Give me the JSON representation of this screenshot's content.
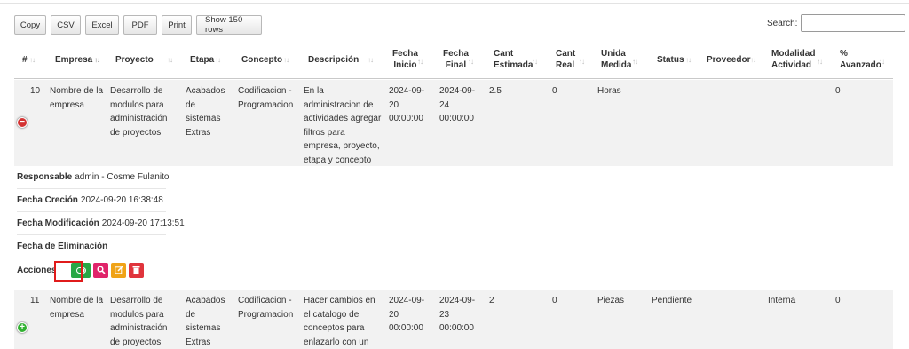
{
  "toolbar": {
    "copy": "Copy",
    "csv": "CSV",
    "excel": "Excel",
    "pdf": "PDF",
    "print": "Print",
    "show_rows": "Show 150 rows"
  },
  "search": {
    "label": "Search:",
    "value": ""
  },
  "columns": [
    "#",
    "Empresa",
    "Proyecto",
    "Etapa",
    "Concepto",
    "Descripción",
    "Fecha Inicio",
    "Fecha Final",
    "Cant Estimada",
    "Cant Real",
    "Unida Medida",
    "Status",
    "Proveedor",
    "Modalidad Actividad",
    "% Avanzado"
  ],
  "columns_display": {
    "id": "#",
    "empresa": "Empresa",
    "proyecto": "Proyecto",
    "etapa": "Etapa",
    "concepto": "Concepto",
    "descripcion": "Descripción",
    "fecha_inicio_1": "Fecha",
    "fecha_inicio_2": "Inicio",
    "fecha_final_1": "Fecha",
    "fecha_final_2": "Final",
    "cant_est_1": "Cant",
    "cant_est_2": "Estimada",
    "cant_real_1": "Cant",
    "cant_real_2": "Real",
    "unidad_1": "Unida",
    "unidad_2": "Medida",
    "status": "Status",
    "proveedor": "Proveedor",
    "modalidad_1": "Modalidad",
    "modalidad_2": "Actividad",
    "avance_1": "%",
    "avance_2": "Avanzado"
  },
  "rows": [
    {
      "id": "10",
      "empresa": [
        "Nombre de la",
        "empresa"
      ],
      "proyecto": [
        "Desarrollo de",
        "modulos para",
        "administración",
        "de proyectos"
      ],
      "etapa": [
        "Acabados",
        "de",
        "sistemas",
        "Extras"
      ],
      "concepto": [
        "Codificacion -",
        "Programacion"
      ],
      "descripcion": [
        "En la",
        "administracion de",
        "actividades agregar",
        "filtros para",
        "empresa, proyecto,",
        "etapa y concepto"
      ],
      "fecha_inicio": [
        "2024-09-",
        "20",
        "00:00:00"
      ],
      "fecha_final": [
        "2024-09-",
        "24",
        "00:00:00"
      ],
      "cant_estimada": "2.5",
      "cant_real": "0",
      "unidad": "Horas",
      "status": "",
      "proveedor": "",
      "modalidad": "",
      "avance": "0",
      "expanded": true
    },
    {
      "id": "11",
      "empresa": [
        "Nombre de la",
        "empresa"
      ],
      "proyecto": [
        "Desarrollo de",
        "modulos para",
        "administración",
        "de proyectos"
      ],
      "etapa": [
        "Acabados",
        "de",
        "sistemas",
        "Extras"
      ],
      "concepto": [
        "Codificacion -",
        "Programacion"
      ],
      "descripcion": [
        "Hacer cambios en",
        "el catalogo de",
        "conceptos para",
        "enlazarlo con un"
      ],
      "fecha_inicio": [
        "2024-09-",
        "20",
        "00:00:00"
      ],
      "fecha_final": [
        "2024-09-",
        "23",
        "00:00:00"
      ],
      "cant_estimada": "2",
      "cant_real": "0",
      "unidad": "Piezas",
      "status": "Pendiente",
      "proveedor": "",
      "modalidad": "Interna",
      "avance": "0",
      "expanded": false
    }
  ],
  "detail": {
    "responsable_label": "Responsable",
    "responsable_value": "admin - Cosme Fulanito",
    "creacion_label": "Fecha Creción",
    "creacion_value": "2024-09-20 16:38:48",
    "modificacion_label": "Fecha Modificación",
    "modificacion_value": "2024-09-20 17:13:51",
    "eliminacion_label": "Fecha de Eliminación",
    "eliminacion_value": "",
    "acciones_label": "Acciones"
  },
  "action_icons": [
    "toggle-icon",
    "search-icon",
    "edit-icon",
    "trash-icon"
  ],
  "colors": {
    "green": "#28a745",
    "pink": "#e0246a",
    "orange": "#f0a317",
    "red": "#e0343c",
    "highlight": "#e01b1b"
  }
}
